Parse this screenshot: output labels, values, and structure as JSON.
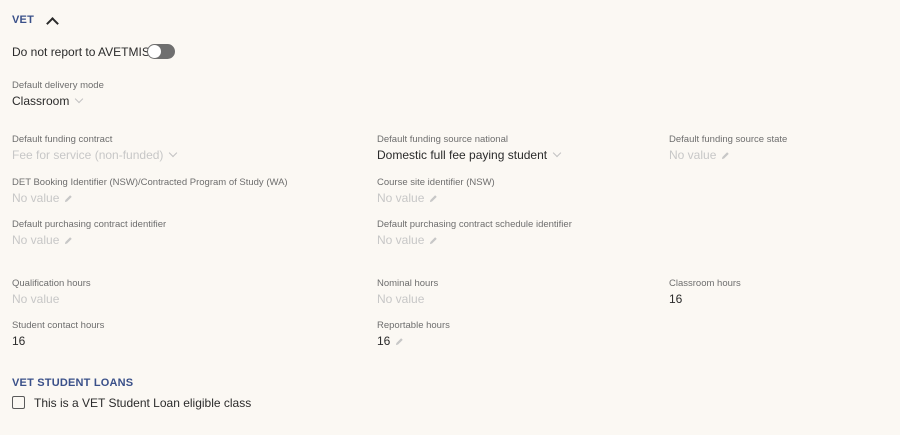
{
  "vet": {
    "title": "VET",
    "avetmiss_toggle_label": "Do not report to AVETMISS",
    "avetmiss_toggle_on": false,
    "delivery_mode": {
      "label": "Default delivery mode",
      "value": "Classroom"
    },
    "funding_contract": {
      "label": "Default funding contract",
      "value": "Fee for service (non-funded)"
    },
    "funding_source_national": {
      "label": "Default funding source national",
      "value": "Domestic full fee paying student"
    },
    "funding_source_state": {
      "label": "Default funding source state",
      "value": "No value"
    },
    "det_booking": {
      "label": "DET Booking Identifier (NSW)/Contracted Program of Study (WA)",
      "value": "No value"
    },
    "course_site": {
      "label": "Course site identifier (NSW)",
      "value": "No value"
    },
    "purchasing_contract": {
      "label": "Default purchasing contract identifier",
      "value": "No value"
    },
    "purchasing_schedule": {
      "label": "Default purchasing contract schedule identifier",
      "value": "No value"
    },
    "qualification_hours": {
      "label": "Qualification hours",
      "value": "No value"
    },
    "nominal_hours": {
      "label": "Nominal hours",
      "value": "No value"
    },
    "classroom_hours": {
      "label": "Classroom hours",
      "value": "16"
    },
    "student_contact_hours": {
      "label": "Student contact hours",
      "value": "16"
    },
    "reportable_hours": {
      "label": "Reportable hours",
      "value": "16"
    }
  },
  "student_loans": {
    "title": "VET STUDENT LOANS",
    "eligible_label": "This is a VET Student Loan eligible class",
    "eligible_checked": false
  },
  "icons": {
    "collapse": "chevron-up-icon",
    "dropdown": "chevron-down-icon",
    "edit": "pencil-icon"
  }
}
